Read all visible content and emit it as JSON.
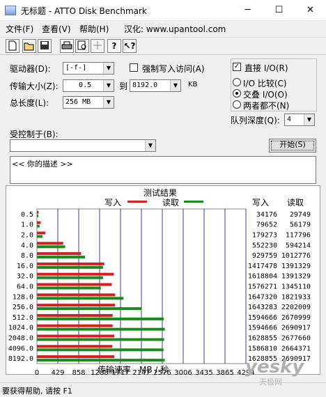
{
  "window": {
    "title": "无标题 - ATTO Disk Benchmark",
    "minimize": "─",
    "maximize": "☐",
    "close": "✕"
  },
  "menu": {
    "file": "文件(F)",
    "view": "查看(V)",
    "help": "帮助(H)",
    "credit": "汉化: www.upantool.com"
  },
  "toolbar": [
    "new-icon",
    "open-icon",
    "save-icon",
    "print-icon",
    "print-preview-icon",
    "move-icon",
    "help-icon",
    "context-help-icon"
  ],
  "settings": {
    "drive_label": "驱动器(D):",
    "drive_value": "[-f-]",
    "force_write_label": "强制写入访问(A)",
    "transfer_label": "传输大小(Z):",
    "transfer_from": "0.5",
    "to_label": "到",
    "transfer_to": "8192.0",
    "unit": "KB",
    "length_label": "总长度(L):",
    "length_value": "256 MB",
    "controlled_label": "受控制于(B):",
    "controlled_value": "",
    "direct_io_label": "直接 I/O(R)",
    "io_compare_label": "I/O 比较(C)",
    "overlapped_io_label": "交叠 I/O(O)",
    "neither_label": "两者都不(N)",
    "queue_label": "队列深度(Q):",
    "queue_value": "4",
    "start_button": "开始(S)",
    "description": "<<  你的描述   >>"
  },
  "results": {
    "title": "测试结果",
    "legend_write": "写入",
    "legend_read": "读取",
    "col_write": "写入",
    "col_read": "读取",
    "x_axis_label": "传输速率 - MB / 秒"
  },
  "colors": {
    "write": "#d42020",
    "read": "#1a8c1a",
    "grid": "#3a3aa8"
  },
  "chart_data": {
    "type": "bar",
    "categories": [
      "0.5",
      "1.0",
      "2.0",
      "4.0",
      "8.0",
      "16.0",
      "32.0",
      "64.0",
      "128.0",
      "256.0",
      "512.0",
      "1024.0",
      "2048.0",
      "4096.0",
      "8192.0"
    ],
    "series": [
      {
        "name": "写入",
        "values": [
          34176,
          79652,
          179273,
          552230,
          929759,
          1417478,
          1618804,
          1576271,
          1647320,
          1643283,
          1594666,
          1594666,
          1628855,
          1586810,
          1628855
        ]
      },
      {
        "name": "读取",
        "values": [
          29749,
          56179,
          117796,
          594214,
          1012776,
          1391329,
          1391329,
          1345110,
          1821933,
          2202009,
          2670999,
          2690917,
          2677660,
          2664371,
          2690917
        ]
      }
    ],
    "xticks": [
      "0",
      "429",
      "858",
      "1288",
      "1717",
      "2147",
      "2576",
      "3006",
      "3435",
      "3865",
      "4294"
    ],
    "xlim_kb": [
      0,
      4398046
    ],
    "xlabel": "传输速率 - MB / 秒",
    "grid": true
  },
  "status": {
    "text": "要获得帮助, 请按 F1"
  },
  "watermark": {
    "text": "yesky",
    "sub": "天极网"
  }
}
